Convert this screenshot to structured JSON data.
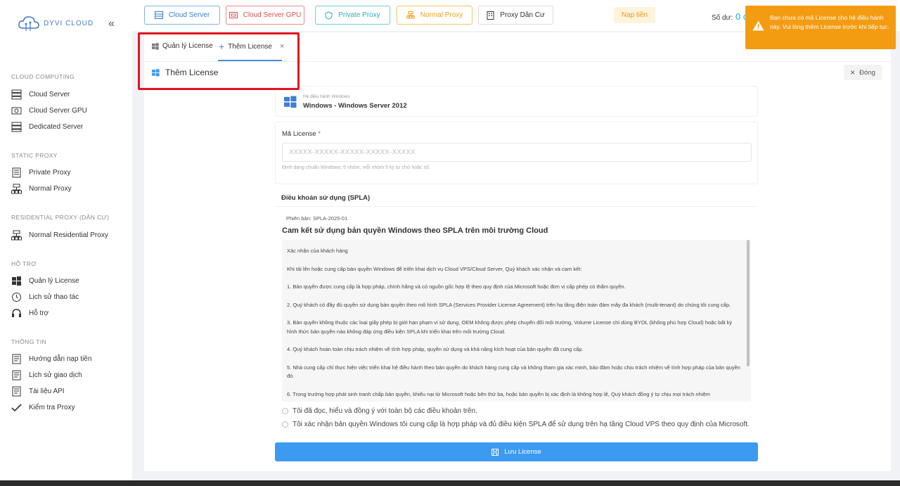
{
  "sidebar": {
    "logo_text": "DYVI CLOUD",
    "sections": [
      {
        "title": "CLOUD COMPUTING",
        "items": [
          "Cloud Server",
          "Cloud Server GPU",
          "Dedicated Server"
        ]
      },
      {
        "title": "STATIC PROXY",
        "items": [
          "Private Proxy",
          "Normal Proxy"
        ]
      },
      {
        "title": "RESIDENTIAL PROXY (DÂN CƯ)",
        "items": [
          "Normal Residential Proxy"
        ]
      },
      {
        "title": "HỖ TRỢ",
        "items": [
          "Quản lý License",
          "Lịch sử thao tác",
          "Hỗ trợ"
        ]
      },
      {
        "title": "THÔNG TIN",
        "items": [
          "Hướng dẫn nạp tiền",
          "Lịch sử giao dịch",
          "Tài liệu API",
          "Kiểm tra Proxy"
        ]
      }
    ]
  },
  "topbar": {
    "buttons": [
      "Cloud Server",
      "Cloud Server GPU",
      "Private Proxy",
      "Normal Proxy",
      "Proxy Dân Cư"
    ],
    "nap_tien": "Nạp tiền",
    "balance_label": "Số dư:",
    "balance_value": "0 đ"
  },
  "tabs": {
    "manage": "Quản lý License",
    "add": "Thêm License",
    "close_symbol": "×"
  },
  "page": {
    "title": "Thêm License",
    "close_label": "Đóng"
  },
  "os": {
    "sub_label": "Hệ điều hành Windows",
    "name": "Windows - Windows Server 2012"
  },
  "license": {
    "label": "Mã License",
    "required": "*",
    "placeholder": "XXXXX-XXXXX-XXXXX-XXXXX-XXXXX",
    "hint": "Định dạng chuẩn Windows: 5 nhóm, mỗi nhóm 5 ký tự chữ hoặc số."
  },
  "terms": {
    "title": "Điều khoản sử dụng (SPLA)",
    "version": "Phiên bản: SPLA-2025-01",
    "heading": "Cam kết sử dụng bản quyền Windows theo SPLA trên môi trường Cloud",
    "paragraphs": [
      "Xác nhận của khách hàng",
      "Khi tải lên hoặc cung cấp bản quyền Windows để triển khai dịch vụ Cloud VPS/Cloud Server, Quý khách xác nhận và cam kết:",
      "1. Bản quyền được cung cấp là hợp pháp, chính hãng và có nguồn gốc hợp lệ theo quy định của Microsoft hoặc đơn vị cấp phép có thẩm quyền.",
      "2. Quý khách có đầy đủ quyền sử dụng bản quyền theo mô hình SPLA (Services Provider License Agreement) trên hạ tầng điện toán đám mây đa khách (multi-tenant) do chúng tôi cung cấp.",
      "3. Bản quyền không thuộc các loại giấy phép bị giới hạn phạm vi sử dụng, OEM không được phép chuyển đổi môi trường, Volume License chỉ dùng BYOL (không phù hợp Cloud) hoặc bất kỳ hình thức bản quyền nào không đáp ứng điều kiện SPLA khi triển khai trên môi trường Cloud.",
      "4. Quý khách hoàn toàn chịu trách nhiệm về tính hợp pháp, quyền sử dụng và khả năng kích hoạt của bản quyền đã cung cấp.",
      "5. Nhà cung cấp chỉ thực hiện việc triển khai hệ điều hành theo bản quyền do khách hàng cung cấp và không tham gia xác minh, bảo đảm hoặc chịu trách nhiệm về tính hợp pháp của bản quyền đó.",
      "6. Trong trường hợp phát sinh tranh chấp bản quyền, khiếu nại từ Microsoft hoặc bên thứ ba, hoặc bản quyền bị xác định là không hợp lệ, Quý khách đồng ý tự chịu mọi trách nhiệm"
    ],
    "check1": "Tôi đã đọc, hiểu và đồng ý với toàn bộ các điều khoản trên.",
    "check2": "Tôi xác nhận bản quyền Windows tôi cung cấp là hợp pháp và đủ điều kiện SPLA để sử dụng trên hạ tầng Cloud VPS theo quy định của Microsoft."
  },
  "save_button": "Lưu License",
  "toast": {
    "message": "Bạn chưa có mã License cho hệ điều hành này. Vui lòng thêm License trước khi tiếp tục.",
    "color": "#f39c12"
  },
  "colors": {
    "primary": "#3d9af1",
    "highlight": "#e0151f"
  }
}
